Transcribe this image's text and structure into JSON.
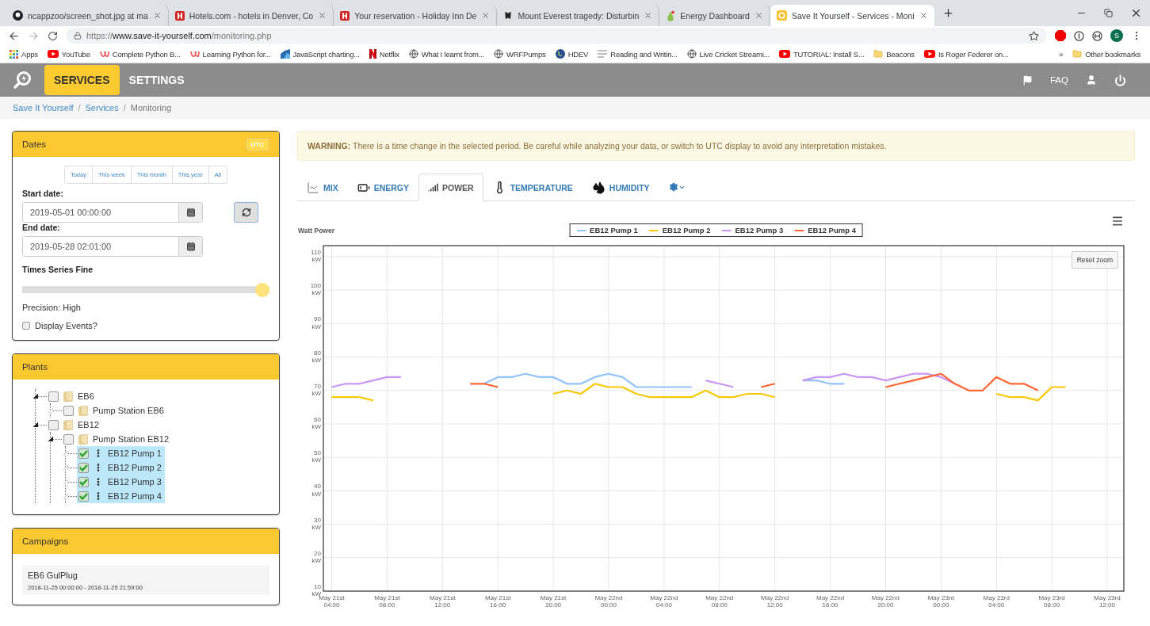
{
  "browser": {
    "tabs": [
      {
        "title": "ncappzoo/screen_shot.jpg at ma",
        "selected": false
      },
      {
        "title": "Hotels.com - hotels in Denver, Co",
        "selected": false
      },
      {
        "title": "Your reservation - Holiday Inn De",
        "selected": false
      },
      {
        "title": "Mount Everest tragedy: Disturbin",
        "selected": false
      },
      {
        "title": "Energy Dashboard",
        "selected": false
      },
      {
        "title": "Save It Yourself - Services - Moni",
        "selected": true
      }
    ],
    "address": {
      "scheme": "https://",
      "host": "www.save-it-yourself.com",
      "path": "/monitoring.php"
    },
    "profile": "S",
    "bookmarks": [
      "Apps",
      "YouTube",
      "Complete Python B...",
      "Learning Python for...",
      "JavaScript charting...",
      "Netflix",
      "What I learnt from...",
      "WRFPumps",
      "HDEV",
      "Reading and Writin...",
      "Live Cricket Streami...",
      "TUTORIAL: Install S...",
      "Beacons",
      "Is Roger Federer on..."
    ],
    "overflow": "»",
    "other_bookmarks": "Other bookmarks"
  },
  "nav": {
    "items": [
      {
        "label": "SERVICES",
        "selected": true
      },
      {
        "label": "SETTINGS",
        "selected": false
      }
    ],
    "faq": "FAQ"
  },
  "breadcrumb": [
    {
      "label": "Save It Yourself",
      "current": false
    },
    {
      "label": "Services",
      "current": false,
      "separator": "/"
    },
    {
      "label": "Monitoring",
      "current": true,
      "separator": "/"
    }
  ],
  "dates": {
    "title": "Dates",
    "utc": "UTC",
    "ranges": [
      "Today",
      "This week",
      "This month",
      "This year",
      "All"
    ],
    "start_label": "Start date:",
    "start_value": "2019-05-01 00:00:00",
    "end_label": "End date:",
    "end_value": "2019-05-28 02:01:00",
    "slider_label": "Times Series Fine",
    "level": 1,
    "precision": "Precision: High",
    "events": {
      "label": "Display Events?",
      "checked": false
    }
  },
  "plants": {
    "title": "Plants",
    "tree": [
      {
        "label": "EB6",
        "kind": "folder",
        "checked": false,
        "selected": false,
        "expanded": true,
        "children": [
          {
            "label": "Pump Station EB6",
            "kind": "folder",
            "checked": false,
            "selected": false,
            "expanded": false
          }
        ]
      },
      {
        "label": "EB12",
        "kind": "folder",
        "checked": false,
        "selected": false,
        "expanded": true,
        "children": [
          {
            "label": "Pump Station EB12",
            "kind": "folder",
            "checked": false,
            "selected": false,
            "expanded": true,
            "children": [
              {
                "label": "EB12 Pump 1",
                "kind": "device",
                "checked": true,
                "selected": true,
                "expanded": false
              },
              {
                "label": "EB12 Pump 2",
                "kind": "device",
                "checked": true,
                "selected": true,
                "expanded": false
              },
              {
                "label": "EB12 Pump 3",
                "kind": "device",
                "checked": true,
                "selected": true,
                "expanded": false
              },
              {
                "label": "EB12 Pump 4",
                "kind": "device",
                "checked": true,
                "selected": true,
                "expanded": false
              }
            ]
          }
        ]
      }
    ]
  },
  "campaigns": {
    "title": "Campaigns",
    "items": [
      {
        "name": "EB6 GulPlug",
        "period": "2018-11-25 00:00:00 - 2018-11-25 21:59:00"
      }
    ]
  },
  "warning": "**WARNING:** There is a time change in the selected period. Be careful while analyzing your data, or switch to UTC display to avoid any interpretation mistakes.",
  "chart_tabs": [
    {
      "label": "MIX",
      "selected": false
    },
    {
      "label": "ENERGY",
      "selected": false
    },
    {
      "label": "POWER",
      "selected": true
    },
    {
      "label": "TEMPERATURE",
      "selected": false
    },
    {
      "label": "HUMIDITY",
      "selected": false
    }
  ],
  "chart": {
    "reset_zoom": "Reset zoom",
    "chart_data": {
      "type": "line",
      "title": "Watt Power",
      "categories": [
        "May 21st\n04:00",
        null,
        null,
        null,
        "May 21st\n08:00",
        null,
        null,
        null,
        "May 21st\n12:00",
        null,
        null,
        null,
        "May 21st\n16:00",
        null,
        null,
        null,
        "May 21st\n20:00",
        null,
        null,
        null,
        "May 22nd\n00:00",
        null,
        null,
        null,
        "May 22nd\n04:00",
        null,
        null,
        null,
        "May 22nd\n08:00",
        null,
        null,
        null,
        "May 22nd\n12:00",
        null,
        null,
        null,
        "May 22nd\n16:00",
        null,
        null,
        null,
        "May 22nd\n20:00",
        null,
        null,
        null,
        "May 23rd\n00:00",
        null,
        null,
        null,
        "May 23rd\n04:00",
        null,
        null,
        null,
        "May 23rd\n08:00",
        null,
        null,
        null,
        "May 23rd\n12:00"
      ],
      "series": [
        {
          "name": "EB12 Pump 1",
          "color": "#90c4fa",
          "values": [
            null,
            null,
            null,
            null,
            null,
            null,
            null,
            null,
            null,
            null,
            null,
            72,
            74,
            74,
            75,
            74,
            74,
            72,
            72,
            74,
            75,
            74,
            71,
            71,
            71,
            71,
            71,
            null,
            null,
            null,
            null,
            null,
            null,
            null,
            73,
            73,
            72,
            72,
            null,
            null,
            null,
            null,
            null,
            null,
            null,
            null,
            null,
            null,
            null,
            null,
            null,
            null,
            null,
            null,
            null,
            null,
            null
          ]
        },
        {
          "name": "EB12 Pump 2",
          "color": "#f8c800",
          "values": [
            68,
            68,
            68,
            67,
            null,
            null,
            null,
            null,
            null,
            null,
            null,
            null,
            null,
            null,
            null,
            null,
            69,
            70,
            69,
            72,
            71,
            71,
            69,
            68,
            68,
            68,
            68,
            70,
            68,
            68,
            69,
            69,
            68,
            null,
            null,
            null,
            null,
            null,
            null,
            null,
            null,
            null,
            null,
            null,
            null,
            null,
            null,
            null,
            69,
            68,
            68,
            67,
            71,
            71,
            null,
            null,
            null
          ]
        },
        {
          "name": "EB12 Pump 3",
          "color": "#c896f5",
          "values": [
            71,
            72,
            72,
            73,
            74,
            74,
            null,
            null,
            null,
            null,
            null,
            null,
            null,
            null,
            null,
            null,
            null,
            null,
            null,
            null,
            null,
            null,
            null,
            null,
            null,
            null,
            null,
            73,
            72,
            71,
            null,
            null,
            null,
            null,
            73,
            74,
            74,
            75,
            74,
            74,
            73,
            74,
            75,
            75,
            74,
            72,
            null,
            null,
            null,
            null,
            null,
            null,
            null,
            null,
            null,
            null,
            null
          ]
        },
        {
          "name": "EB12 Pump 4",
          "color": "#ff6633",
          "values": [
            null,
            null,
            null,
            null,
            null,
            null,
            null,
            null,
            null,
            null,
            72,
            72,
            71,
            null,
            null,
            null,
            null,
            null,
            null,
            null,
            null,
            null,
            null,
            null,
            null,
            null,
            null,
            null,
            null,
            null,
            null,
            71,
            72,
            null,
            null,
            null,
            null,
            null,
            null,
            null,
            71,
            72,
            73,
            74,
            75,
            72,
            70,
            70,
            74,
            72,
            72,
            70,
            null,
            null,
            null,
            null,
            null
          ]
        }
      ],
      "ylim": [
        10,
        113.3
      ],
      "grid": true,
      "legend": "top",
      "yticks": [
        {
          "value": 10,
          "label": "10\nkW"
        },
        {
          "value": 20,
          "label": "20\nkW"
        },
        {
          "value": 30,
          "label": "30\nkW"
        },
        {
          "value": 40,
          "label": "40\nkW"
        },
        {
          "value": 50,
          "label": "50\nkW"
        },
        {
          "value": 60,
          "label": "60\nkW"
        },
        {
          "value": 70,
          "label": "70\nkW"
        },
        {
          "value": 80,
          "label": "80\nkW"
        },
        {
          "value": 90,
          "label": "90\nkW"
        },
        {
          "value": 100,
          "label": "100\nkW"
        },
        {
          "value": 110,
          "label": "110\nkW"
        }
      ]
    }
  }
}
